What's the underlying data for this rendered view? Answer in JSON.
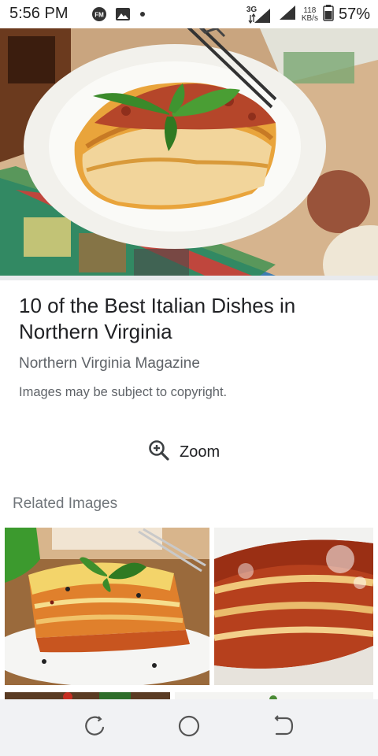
{
  "status_bar": {
    "time": "5:56 PM",
    "network_type": "3G",
    "data_speed_value": "118",
    "data_speed_unit": "KB/s",
    "battery_percent": "57%",
    "icons": [
      "fm-radio-icon",
      "gallery-icon",
      "notification-dot-icon",
      "signal-3g-icon",
      "signal-icon",
      "battery-icon"
    ]
  },
  "hero_image": {
    "subject": "lasagna-with-basil-on-white-plate"
  },
  "result": {
    "title": "10 of the Best Italian Dishes in Northern Virginia",
    "source": "Northern Virginia Magazine",
    "copyright_notice": "Images may be subject to copyright."
  },
  "zoom": {
    "label": "Zoom",
    "icon": "zoom-in-icon"
  },
  "related": {
    "heading": "Related Images"
  },
  "nav_bar": {
    "icons": [
      "recent-apps-icon",
      "home-icon",
      "back-icon"
    ]
  },
  "colors": {
    "text_primary": "#202124",
    "text_secondary": "#5f6368",
    "nav_bar_bg": "#f1f2f4",
    "divider": "#e8eaed"
  }
}
